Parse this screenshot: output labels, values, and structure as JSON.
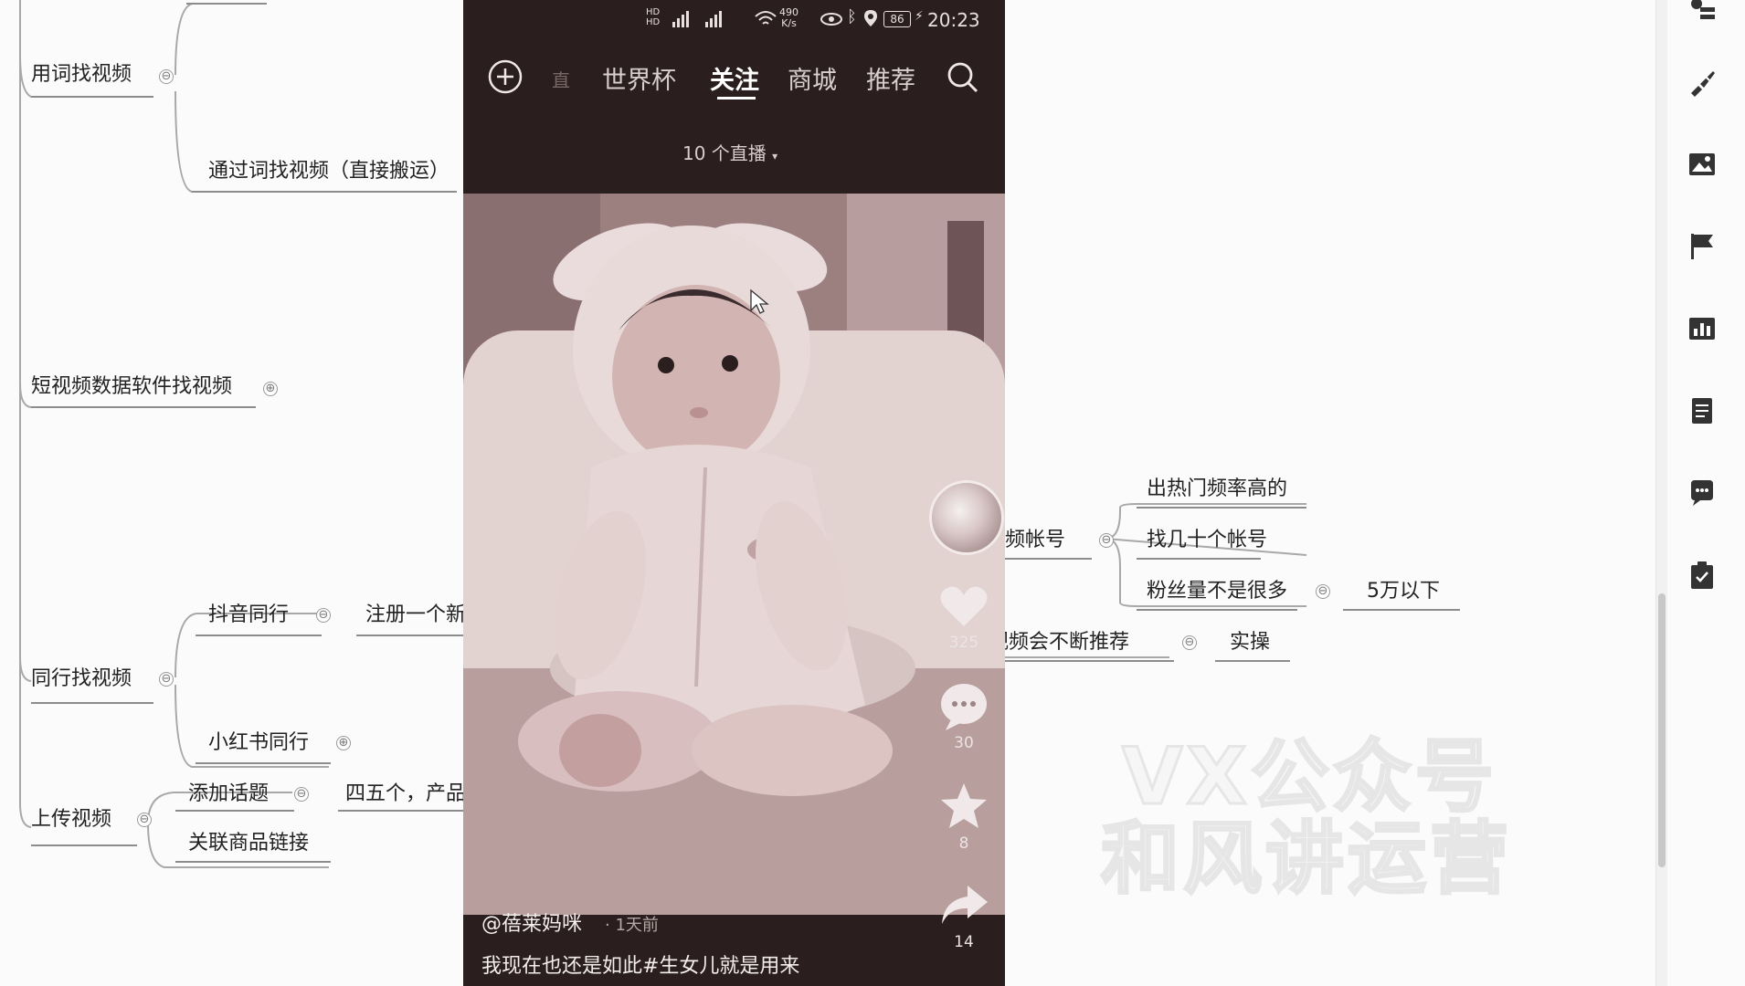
{
  "mindmap": {
    "n_search_by_word": "用词找视频",
    "n_via_word": "通过词找视频（直接搬运）",
    "n_data_software": "短视频数据软件找视频",
    "n_account_partial": "频帐号",
    "n_high_hot": "出热门频率高的",
    "n_find_accounts": "找几十个帐号",
    "n_fans": "粉丝量不是很多",
    "n_50k": "5万以下",
    "n_recommend_partial": "该视频会不断推荐",
    "n_practice": "实操",
    "n_douyin_peer": "抖音同行",
    "n_register_partial": "注册一个新",
    "n_peer_video": "同行找视频",
    "n_xhs_peer": "小红书同行",
    "n_upload": "上传视频",
    "n_add_topic": "添加话题",
    "n_45_partial": "四五个，产品",
    "n_link_goods": "关联商品链接",
    "toggle_collapse": "⊖",
    "toggle_expand": "⊕"
  },
  "watermark": {
    "line1": "VX公众号",
    "line2": "和风讲运营"
  },
  "phone": {
    "status": {
      "network": "490\nK/s",
      "battery": "86",
      "time": "20:23"
    },
    "nav": {
      "tab_partial": "直",
      "tab_worldcup": "世界杯",
      "tab_follow": "关注",
      "tab_mall": "商城",
      "tab_recommend": "推荐"
    },
    "live_count": "10 个直播",
    "live_caret": "▾",
    "likes": "325",
    "comments": "30",
    "favorites": "8",
    "shares": "14",
    "author": "@蓓莱妈咪",
    "time_ago": "· 1天前",
    "caption": "我现在也还是如此#生女儿就是用来"
  },
  "toolbar": {
    "icons": [
      "user-icon",
      "brush-icon",
      "image-icon",
      "flag-icon",
      "chart-icon",
      "note-icon",
      "comment-icon",
      "clipboard-icon"
    ]
  },
  "colors": {
    "phone_bg": "#2a1e1f",
    "line": "#a8a8a8",
    "underline": "#8c8c8c"
  }
}
